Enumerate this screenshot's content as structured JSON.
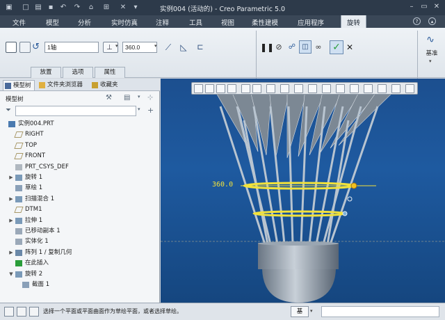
{
  "window": {
    "title": "实例004 (活动的) - Creo Parametric 5.0"
  },
  "menu": {
    "items": [
      "文件",
      "模型",
      "分析",
      "实时仿真",
      "注释",
      "工具",
      "视图",
      "柔性建模",
      "应用程序"
    ],
    "active_tab": "旋转"
  },
  "ribbon": {
    "axis_value": "1轴",
    "angle_value": "360.0",
    "tabs": [
      "放置",
      "选项",
      "属性"
    ],
    "right_label": "基准"
  },
  "left_panel": {
    "tabs": [
      "模型树",
      "文件夹浏览器",
      "收藏夹"
    ],
    "tree_header": "模型树",
    "search_placeholder": "",
    "items": [
      {
        "label": "实例004.PRT",
        "icon": "part-icon",
        "expand": "",
        "indent": 0
      },
      {
        "label": "RIGHT",
        "icon": "datum-plane-icon",
        "expand": "",
        "indent": 1
      },
      {
        "label": "TOP",
        "icon": "datum-plane-icon",
        "expand": "",
        "indent": 1
      },
      {
        "label": "FRONT",
        "icon": "datum-plane-icon",
        "expand": "",
        "indent": 1
      },
      {
        "label": "PRT_CSYS_DEF",
        "icon": "csys-icon",
        "expand": "",
        "indent": 1
      },
      {
        "label": "旋转 1",
        "icon": "revolve-icon",
        "expand": "▶",
        "indent": 1
      },
      {
        "label": "草绘 1",
        "icon": "sketch-icon",
        "expand": "",
        "indent": 1
      },
      {
        "label": "扫描混合 1",
        "icon": "sweep-blend-icon",
        "expand": "▶",
        "indent": 1
      },
      {
        "label": "DTM1",
        "icon": "datum-plane-icon",
        "expand": "",
        "indent": 1
      },
      {
        "label": "拉伸 1",
        "icon": "extrude-icon",
        "expand": "▶",
        "indent": 1
      },
      {
        "label": "已移动副本 1",
        "icon": "moved-copy-icon",
        "expand": "",
        "indent": 1
      },
      {
        "label": "实体化 1",
        "icon": "solidify-icon",
        "expand": "",
        "indent": 1
      },
      {
        "label": "阵列 1 / 复制几何",
        "icon": "pattern-icon",
        "expand": "▶",
        "indent": 1
      },
      {
        "label": "在此插入",
        "icon": "insert-here-icon",
        "expand": "",
        "indent": 1
      },
      {
        "label": "旋转 2",
        "icon": "revolve-icon",
        "expand": "▼",
        "indent": 1
      },
      {
        "label": "截面 1",
        "icon": "section-icon",
        "expand": "",
        "indent": 2
      }
    ]
  },
  "viewport": {
    "dimension_label": "360.0"
  },
  "status": {
    "message": "选择一个平面或平面曲面作为草绘平面，或者选择草绘。",
    "filter_label": "基"
  },
  "colors": {
    "title_bg": "#2d3a4a",
    "menu_bg": "#3a4757",
    "viewport_top": "#1c4f8f",
    "confirm_green": "#2a9d3a",
    "highlight_yellow": "#f2e23a"
  }
}
